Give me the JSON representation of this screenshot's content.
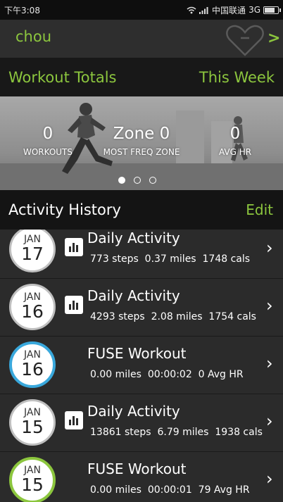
{
  "status_bar": {
    "time": "下午3:08",
    "carrier": "中国联通",
    "network": "3G"
  },
  "header": {
    "username": "chou"
  },
  "totals": {
    "title": "Workout Totals",
    "period": "This Week"
  },
  "stats": [
    {
      "value": "0",
      "label": "WORKOUTS"
    },
    {
      "value": "Zone 0",
      "label": "MOST FREQ ZONE"
    },
    {
      "value": "0",
      "label": "AVG HR"
    }
  ],
  "carousel": {
    "pages": 3,
    "active_index": 0
  },
  "history": {
    "title": "Activity History",
    "edit_label": "Edit"
  },
  "activities": [
    {
      "month": "JAN",
      "day": "17",
      "title": "Daily Activity",
      "s1": "773 steps",
      "s2": "0.37 miles",
      "s3": "1748 cals",
      "icon": "bar-chart-icon",
      "ring": "gray"
    },
    {
      "month": "JAN",
      "day": "16",
      "title": "Daily Activity",
      "s1": "4293 steps",
      "s2": "2.08 miles",
      "s3": "1754 cals",
      "icon": "bar-chart-icon",
      "ring": "gray"
    },
    {
      "month": "JAN",
      "day": "16",
      "title": "FUSE Workout",
      "s1": "0.00 miles",
      "s2": "00:00:02",
      "s3": "0 Avg HR",
      "icon": "",
      "ring": "#39a8dc"
    },
    {
      "month": "JAN",
      "day": "15",
      "title": "Daily Activity",
      "s1": "13861 steps",
      "s2": "6.79 miles",
      "s3": "1938 cals",
      "icon": "bar-chart-icon",
      "ring": "gray"
    },
    {
      "month": "JAN",
      "day": "15",
      "title": "FUSE Workout",
      "s1": "0.00 miles",
      "s2": "00:00:01",
      "s3": "79 Avg HR",
      "icon": "",
      "ring": "#8cc63e"
    }
  ],
  "colors": {
    "accent": "#8cc63e",
    "workout_ring_blue": "#39a8dc"
  }
}
